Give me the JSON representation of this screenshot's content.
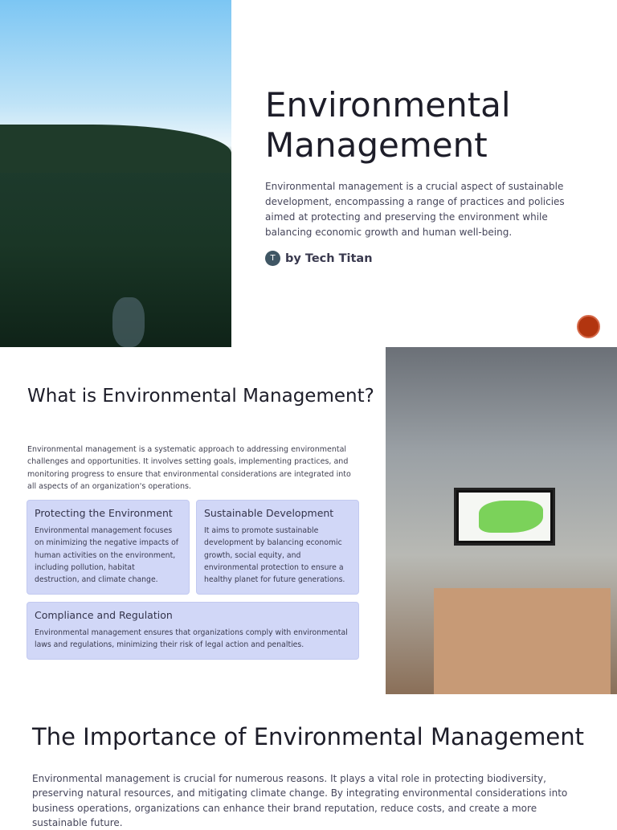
{
  "hero": {
    "title": "Environmental Management",
    "description": "Environmental management is a crucial aspect of sustainable development, encompassing a range of practices and policies aimed at protecting and preserving the environment while balancing economic growth and human well-being.",
    "author_initial": "T",
    "author": "by Tech Titan"
  },
  "section1": {
    "title": "What is Environmental Management?",
    "intro": "Environmental management is a systematic approach to addressing environmental challenges and opportunities. It involves setting goals, implementing practices, and monitoring progress to ensure that environmental considerations are integrated into all aspects of an organization's operations.",
    "cards": [
      {
        "title": "Protecting the Environment",
        "text": "Environmental management focuses on minimizing the negative impacts of human activities on the environment, including pollution, habitat destruction, and climate change."
      },
      {
        "title": "Sustainable Development",
        "text": "It aims to promote sustainable development by balancing economic growth, social equity, and environmental protection to ensure a healthy planet for future generations."
      },
      {
        "title": "Compliance and Regulation",
        "text": "Environmental management ensures that organizations comply with environmental laws and regulations, minimizing their risk of legal action and penalties."
      }
    ]
  },
  "section2": {
    "title": "The Importance of Environmental Management",
    "text": "Environmental management is crucial for numerous reasons. It plays a vital role in protecting biodiversity, preserving natural resources, and mitigating climate change. By integrating environmental considerations into business operations, organizations can enhance their brand reputation, reduce costs, and create a more sustainable future."
  }
}
